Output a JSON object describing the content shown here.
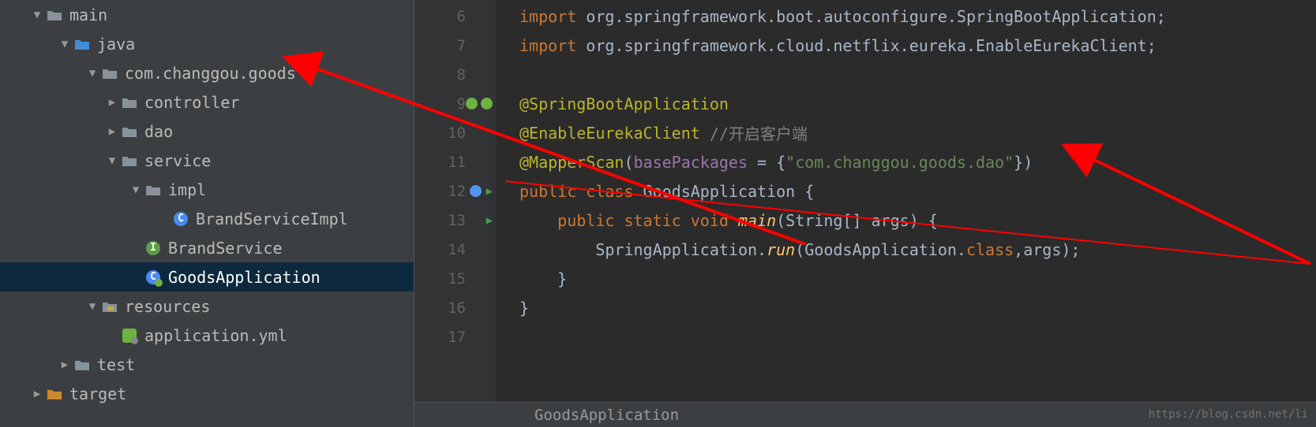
{
  "tree": {
    "main": "main",
    "java": "java",
    "pkg": "com.changgou.goods",
    "controller": "controller",
    "dao": "dao",
    "service": "service",
    "impl": "impl",
    "brandServiceImpl": "BrandServiceImpl",
    "brandService": "BrandService",
    "goodsApp": "GoodsApplication",
    "resources": "resources",
    "applicationYml": "application.yml",
    "test": "test",
    "target": "target"
  },
  "lines": [
    "6",
    "7",
    "8",
    "9",
    "10",
    "11",
    "12",
    "13",
    "14",
    "15",
    "16",
    "17"
  ],
  "code": {
    "l6a": "import ",
    "l6b": "org.springframework.boot.autoconfigure.",
    "l6c": "SpringBootApplication",
    "l6d": ";",
    "l7a": "import ",
    "l7b": "org.springframework.cloud.netflix.eureka.",
    "l7c": "EnableEurekaClient",
    "l7d": ";",
    "l9": "@SpringBootApplication",
    "l10a": "@EnableEurekaClient",
    "l10b": " //开启客户端",
    "l11a": "@MapperScan",
    "l11b": "(",
    "l11c": "basePackages ",
    "l11d": "= {",
    "l11e": "\"com.changgou.goods.dao\"",
    "l11f": "})",
    "l12a": "public class ",
    "l12b": "GoodsApplication ",
    "l12c": "{",
    "l13a": "    public static void ",
    "l13b": "main",
    "l13c": "(String[] args) {",
    "l14a": "        SpringApplication.",
    "l14b": "run",
    "l14c": "(GoodsApplication.",
    "l14d": "class",
    "l14e": ",args);",
    "l15": "    }",
    "l16": "}"
  },
  "breadcrumb": "GoodsApplication",
  "watermark": "https://blog.csdn.net/li"
}
